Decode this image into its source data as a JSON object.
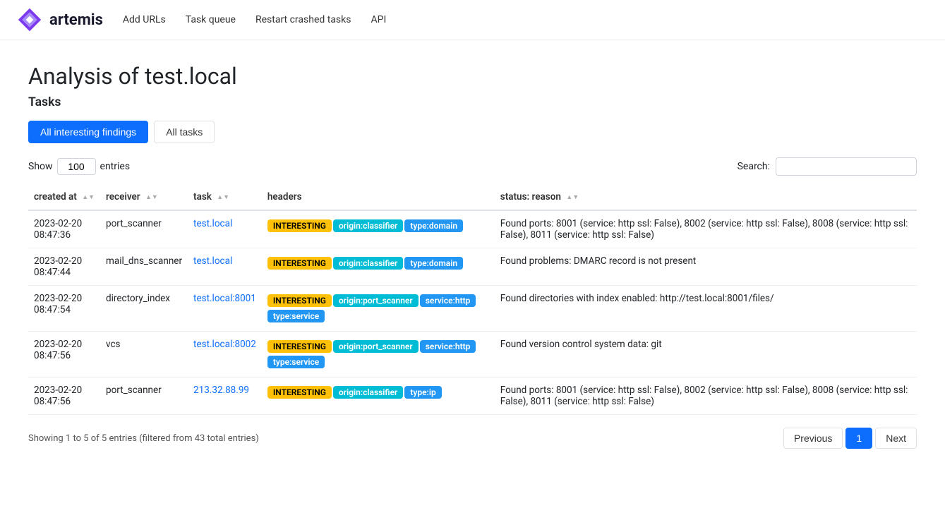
{
  "brand": {
    "name": "artemis"
  },
  "nav": {
    "links": [
      {
        "label": "Add URLs",
        "href": "#"
      },
      {
        "label": "Task queue",
        "href": "#"
      },
      {
        "label": "Restart crashed tasks",
        "href": "#"
      },
      {
        "label": "API",
        "href": "#"
      }
    ]
  },
  "page": {
    "title": "Analysis of test.local",
    "subtitle": "Tasks"
  },
  "tabs": [
    {
      "id": "interesting",
      "label": "All interesting findings",
      "active": true
    },
    {
      "id": "all",
      "label": "All tasks",
      "active": false
    }
  ],
  "controls": {
    "show_label": "Show",
    "show_value": "100",
    "entries_label": "entries",
    "search_label": "Search:"
  },
  "table": {
    "columns": [
      {
        "key": "created_at",
        "label": "created at"
      },
      {
        "key": "receiver",
        "label": "receiver"
      },
      {
        "key": "task",
        "label": "task"
      },
      {
        "key": "headers",
        "label": "headers"
      },
      {
        "key": "status_reason",
        "label": "status: reason"
      }
    ],
    "rows": [
      {
        "created_at": "2023-02-20\n08:47:36",
        "receiver": "port_scanner",
        "task": "test.local",
        "task_href": "#",
        "badges": [
          {
            "text": "INTERESTING",
            "type": "interesting"
          },
          {
            "text": "origin:classifier",
            "type": "origin-classifier"
          },
          {
            "text": "type:domain",
            "type": "type-domain"
          }
        ],
        "status_reason": "Found ports: 8001 (service: http ssl: False), 8002 (service: http ssl: False), 8008 (service: http ssl: False), 8011 (service: http ssl: False)"
      },
      {
        "created_at": "2023-02-20\n08:47:44",
        "receiver": "mail_dns_scanner",
        "task": "test.local",
        "task_href": "#",
        "badges": [
          {
            "text": "INTERESTING",
            "type": "interesting"
          },
          {
            "text": "origin:classifier",
            "type": "origin-classifier"
          },
          {
            "text": "type:domain",
            "type": "type-domain"
          }
        ],
        "status_reason": "Found problems: DMARC record is not present"
      },
      {
        "created_at": "2023-02-20\n08:47:54",
        "receiver": "directory_index",
        "task": "test.local:8001",
        "task_href": "#",
        "badges": [
          {
            "text": "INTERESTING",
            "type": "interesting"
          },
          {
            "text": "origin:port_scanner",
            "type": "origin-port-scanner"
          },
          {
            "text": "service:http",
            "type": "service-http"
          },
          {
            "text": "type:service",
            "type": "type-service"
          }
        ],
        "status_reason": "Found directories with index enabled: http://test.local:8001/files/"
      },
      {
        "created_at": "2023-02-20\n08:47:56",
        "receiver": "vcs",
        "task": "test.local:8002",
        "task_href": "#",
        "badges": [
          {
            "text": "INTERESTING",
            "type": "interesting"
          },
          {
            "text": "origin:port_scanner",
            "type": "origin-port-scanner"
          },
          {
            "text": "service:http",
            "type": "service-http"
          },
          {
            "text": "type:service",
            "type": "type-service"
          }
        ],
        "status_reason": "Found version control system data: git"
      },
      {
        "created_at": "2023-02-20\n08:47:56",
        "receiver": "port_scanner",
        "task": "213.32.88.99",
        "task_href": "#",
        "badges": [
          {
            "text": "INTERESTING",
            "type": "interesting"
          },
          {
            "text": "origin:classifier",
            "type": "origin-classifier"
          },
          {
            "text": "type:ip",
            "type": "type-ip"
          }
        ],
        "status_reason": "Found ports: 8001 (service: http ssl: False), 8002 (service: http ssl: False), 8008 (service: http ssl: False), 8011 (service: http ssl: False)"
      }
    ]
  },
  "pagination": {
    "info": "Showing 1 to 5 of 5 entries (filtered from 43 total entries)",
    "prev_label": "Previous",
    "next_label": "Next",
    "current_page": "1"
  }
}
